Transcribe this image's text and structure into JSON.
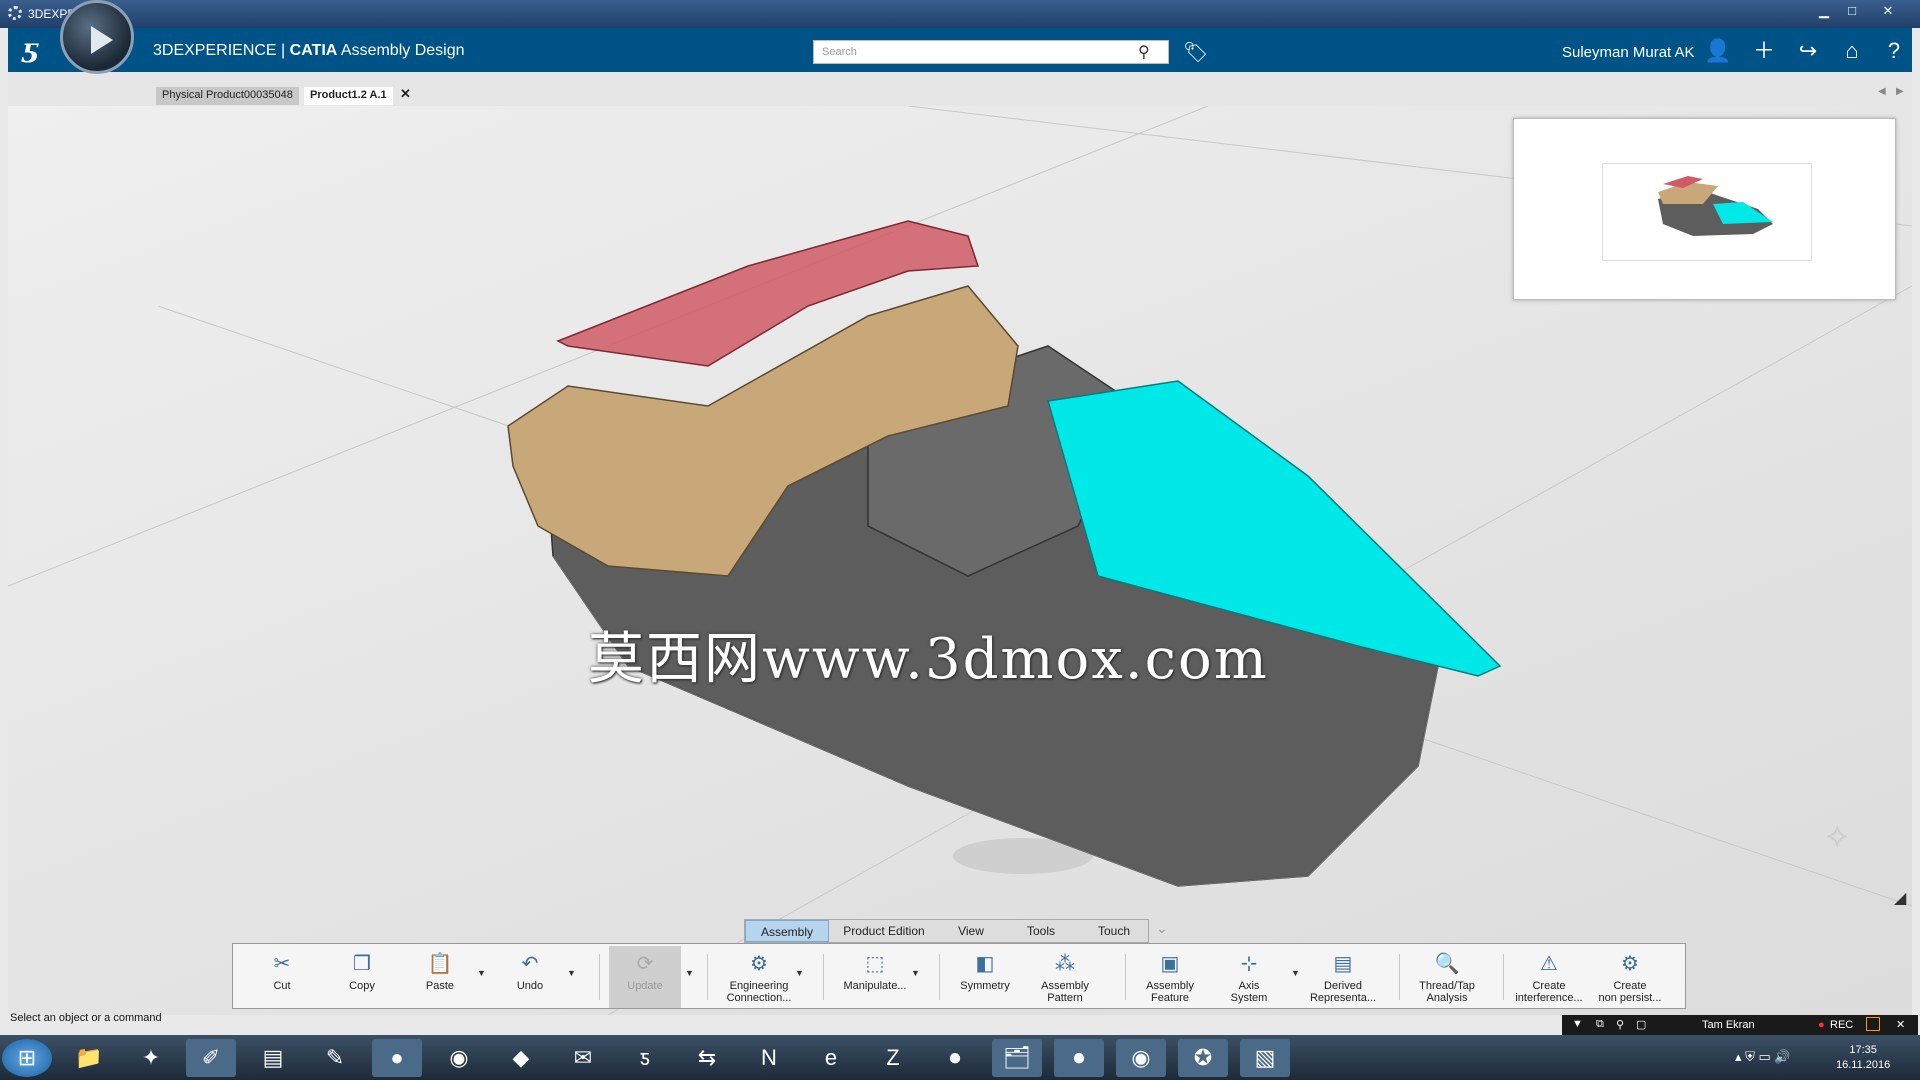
{
  "window": {
    "title": "3DEXPERIENCE",
    "minimize": "▁",
    "maximize": "□",
    "close": "✕"
  },
  "appbar": {
    "brand": "3DEXPERIENCE | ",
    "product": "CATIA",
    "app": "Assembly Design",
    "search_placeholder": "Search",
    "user": "Suleyman Murat AK"
  },
  "tabs": [
    {
      "label": "Physical Product00035048"
    },
    {
      "label": "Product1.2 A.1"
    }
  ],
  "watermark": "莫西网www.3dmox.com",
  "toolbar_tabs": [
    "Assembly",
    "Product Edition",
    "View",
    "Tools",
    "Touch"
  ],
  "active_toolbar_tab": "Assembly",
  "toolbar": {
    "cut": "Cut",
    "copy": "Copy",
    "paste": "Paste",
    "undo": "Undo",
    "update": "Update",
    "engineering_connection": [
      "Engineering",
      "Connection..."
    ],
    "manipulate": "Manipulate...",
    "symmetry": "Symmetry",
    "assembly_pattern": [
      "Assembly",
      "Pattern"
    ],
    "assembly_feature": [
      "Assembly",
      "Feature"
    ],
    "axis_system": [
      "Axis",
      "System"
    ],
    "derived_representation": [
      "Derived",
      "Representa..."
    ],
    "thread_tap": [
      "Thread/Tap",
      "Analysis"
    ],
    "create_interference": [
      "Create",
      "interference..."
    ],
    "create_non_persist": [
      "Create",
      "non persist..."
    ]
  },
  "status": "Select an object or a command",
  "recorder": {
    "label": "Tam Ekran",
    "rec": "REC"
  },
  "clock": {
    "time": "17:35",
    "date": "16.11.2016"
  },
  "colors": {
    "appbar": "#005386",
    "nose": "#00e5e5",
    "seat": "#c8a878",
    "canopy": "#d05060",
    "body": "#5a5a5a"
  }
}
